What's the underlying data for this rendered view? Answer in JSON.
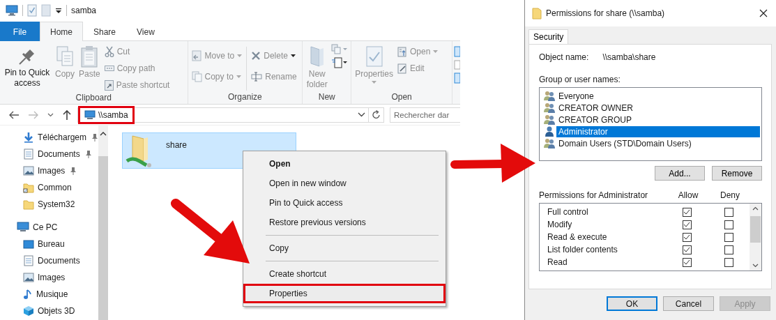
{
  "explorer": {
    "title": "samba",
    "tabs": [
      {
        "label": "File",
        "kind": "menu",
        "selected": false
      },
      {
        "label": "Home",
        "kind": "tab",
        "selected": true
      },
      {
        "label": "Share",
        "kind": "tab",
        "selected": false
      },
      {
        "label": "View",
        "kind": "tab",
        "selected": false
      }
    ],
    "ribbon": {
      "clipboard": {
        "label": "Clipboard",
        "pin": {
          "label": "Pin to Quick access",
          "disabled": false
        },
        "copy": {
          "label": "Copy",
          "disabled": true
        },
        "paste": {
          "label": "Paste",
          "disabled": true
        },
        "cut": {
          "label": "Cut",
          "disabled": true
        },
        "copy_path": {
          "label": "Copy path",
          "disabled": true
        },
        "paste_shortcut": {
          "label": "Paste shortcut",
          "disabled": true
        }
      },
      "organize": {
        "label": "Organize",
        "move_to": {
          "label": "Move to",
          "disabled": true
        },
        "copy_to": {
          "label": "Copy to",
          "disabled": true
        },
        "delete": {
          "label": "Delete",
          "disabled": true
        },
        "rename": {
          "label": "Rename",
          "disabled": true
        }
      },
      "new": {
        "label": "New",
        "new_folder": {
          "label": "New folder",
          "disabled": true
        }
      },
      "open": {
        "label": "Open",
        "properties": {
          "label": "Properties",
          "disabled": true
        },
        "open": {
          "label": "Open",
          "disabled": true
        },
        "edit": {
          "label": "Edit",
          "disabled": true
        }
      }
    },
    "address": {
      "value": "\\\\samba",
      "highlighted": true
    },
    "search": {
      "placeholder": "Rechercher dar"
    },
    "navigation": [
      {
        "label": "Téléchargem",
        "kind": "downloads",
        "pinned": true
      },
      {
        "label": "Documents",
        "kind": "documents",
        "pinned": true
      },
      {
        "label": "Images",
        "kind": "pictures",
        "pinned": true
      },
      {
        "label": "Common",
        "kind": "shortcut-folder",
        "pinned": false
      },
      {
        "label": "System32",
        "kind": "folder",
        "pinned": false
      },
      {
        "label": "Ce PC",
        "kind": "computer",
        "pinned": false,
        "children": [
          {
            "label": "Bureau",
            "kind": "desktop",
            "pinned": false
          },
          {
            "label": "Documents",
            "kind": "documents",
            "pinned": false
          },
          {
            "label": "Images",
            "kind": "pictures",
            "pinned": false
          },
          {
            "label": "Musique",
            "kind": "music",
            "pinned": false
          },
          {
            "label": "Objets 3D",
            "kind": "objects",
            "pinned": false
          }
        ]
      }
    ],
    "items": [
      {
        "name": "share",
        "selected": true
      }
    ],
    "context_menu": [
      {
        "label": "Open",
        "kind": "default",
        "highlighted": false
      },
      {
        "label": "Open in new window",
        "kind": "item",
        "highlighted": false
      },
      {
        "label": "Pin to Quick access",
        "kind": "item",
        "highlighted": false
      },
      {
        "label": "Restore previous versions",
        "kind": "item",
        "highlighted": false
      },
      {
        "kind": "separator"
      },
      {
        "label": "Copy",
        "kind": "item",
        "highlighted": false
      },
      {
        "kind": "separator"
      },
      {
        "label": "Create shortcut",
        "kind": "item",
        "highlighted": false
      },
      {
        "label": "Properties",
        "kind": "item",
        "highlighted": true
      }
    ]
  },
  "dialog": {
    "title": "Permissions for share (\\\\samba)",
    "tabs": [
      {
        "label": "Security",
        "selected": true
      }
    ],
    "object_name_label": "Object name:",
    "object_name": "\\\\samba\\share",
    "groups_label": "Group or user names:",
    "groups": [
      {
        "name": "Everyone",
        "kind": "group",
        "selected": false
      },
      {
        "name": "CREATOR OWNER",
        "kind": "group",
        "selected": false
      },
      {
        "name": "CREATOR GROUP",
        "kind": "group",
        "selected": false
      },
      {
        "name": "Administrator",
        "kind": "user",
        "selected": true
      },
      {
        "name": "Domain Users (STD\\Domain Users)",
        "kind": "group",
        "selected": false
      }
    ],
    "add_button": "Add...",
    "remove_button": "Remove",
    "permissions_label": "Permissions for Administrator",
    "allow_label": "Allow",
    "deny_label": "Deny",
    "permissions": [
      {
        "name": "Full control",
        "allow": true,
        "deny": false
      },
      {
        "name": "Modify",
        "allow": true,
        "deny": false
      },
      {
        "name": "Read & execute",
        "allow": true,
        "deny": false
      },
      {
        "name": "List folder contents",
        "allow": true,
        "deny": false
      },
      {
        "name": "Read",
        "allow": true,
        "deny": false
      }
    ],
    "buttons": [
      {
        "label": "OK",
        "kind": "default",
        "disabled": false
      },
      {
        "label": "Cancel",
        "kind": "normal",
        "disabled": false
      },
      {
        "label": "Apply",
        "kind": "normal",
        "disabled": true
      }
    ]
  }
}
